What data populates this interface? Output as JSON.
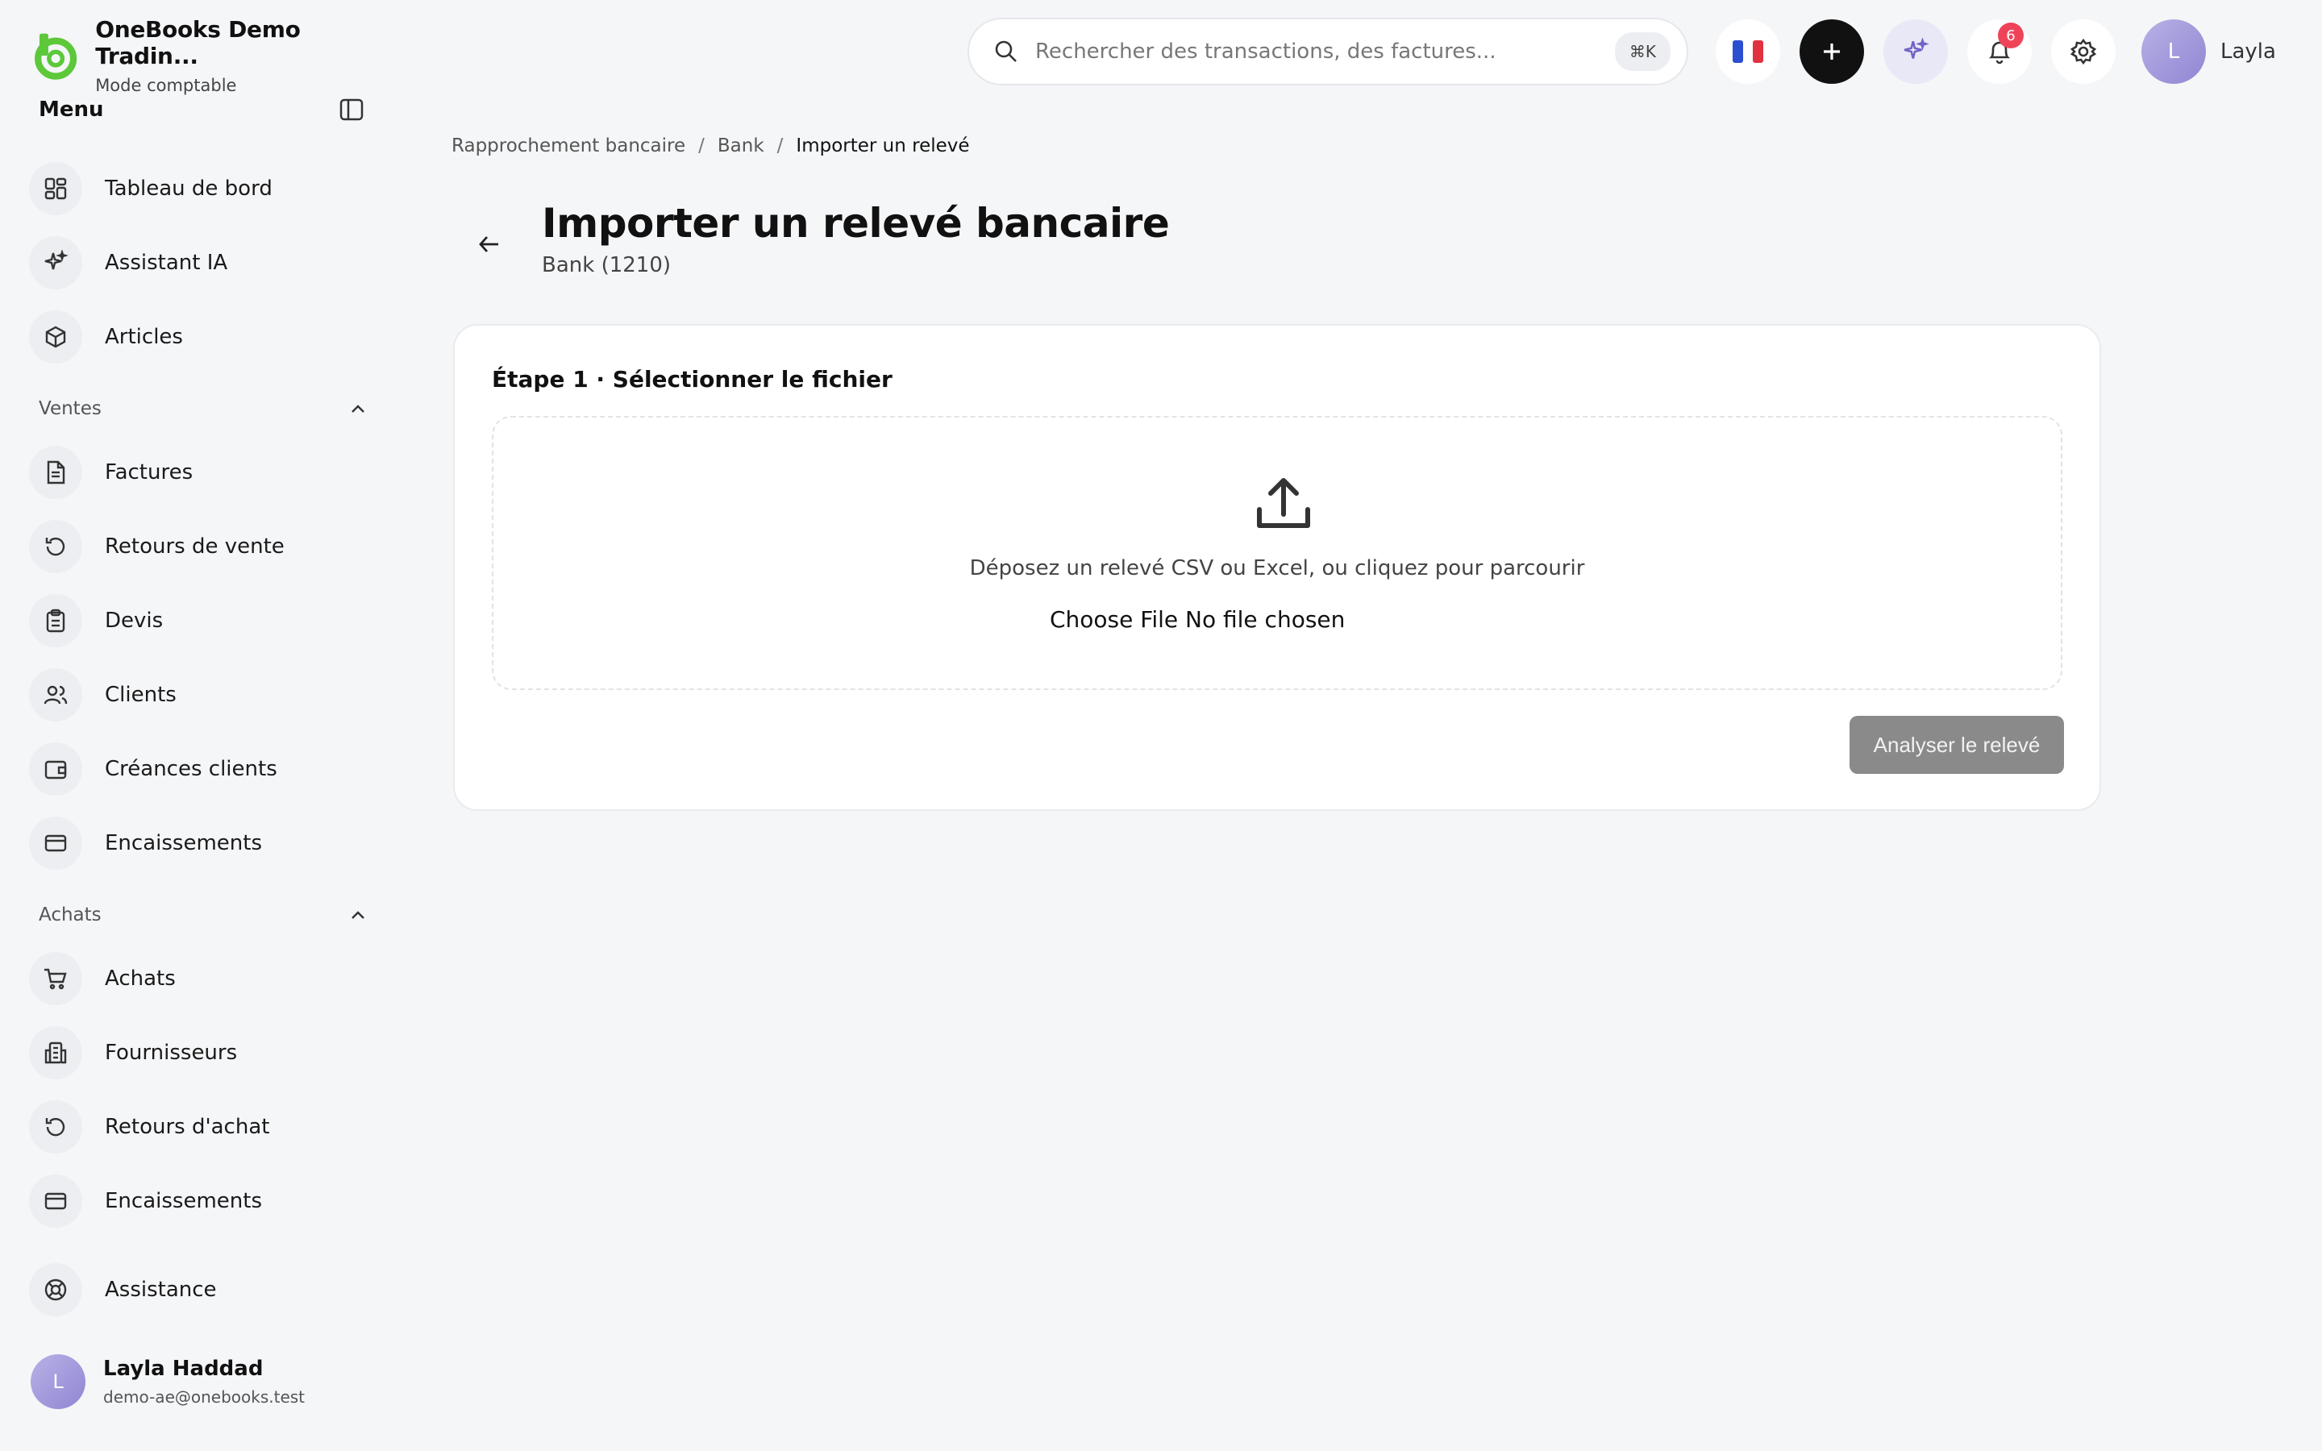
{
  "brand": {
    "name": "OneBooks Demo Tradin...",
    "mode": "Mode comptable",
    "accent": "#5cc83a"
  },
  "menu": {
    "title": "Menu"
  },
  "nav": {
    "dashboard": "Tableau de bord",
    "assistant": "Assistant IA",
    "articles": "Articles",
    "sales_section": "Ventes",
    "invoices": "Factures",
    "sales_returns": "Retours de vente",
    "quotes": "Devis",
    "clients": "Clients",
    "receivables": "Créances clients",
    "collections": "Encaissements",
    "purchases_section": "Achats",
    "purchases": "Achats",
    "suppliers": "Fournisseurs",
    "purchase_returns": "Retours d'achat",
    "payments": "Encaissements",
    "support": "Assistance"
  },
  "user": {
    "initial": "L",
    "full_name": "Layla Haddad",
    "email": "demo-ae@onebooks.test",
    "short_name": "Layla"
  },
  "search": {
    "placeholder": "Rechercher des transactions, des factures...",
    "shortcut": "⌘K"
  },
  "notifications": {
    "count": "6"
  },
  "breadcrumb": {
    "level1": "Rapprochement bancaire",
    "level2": "Bank",
    "current": "Importer un relevé"
  },
  "page": {
    "title": "Importer un relevé bancaire",
    "subtitle": "Bank (1210)"
  },
  "step": {
    "title": "Étape 1 · Sélectionner le fichier",
    "drop_text": "Déposez un relevé CSV ou Excel, ou cliquez pour parcourir",
    "file_input": "Choose File No file chosen",
    "analyze_label": "Analyser le relevé"
  }
}
